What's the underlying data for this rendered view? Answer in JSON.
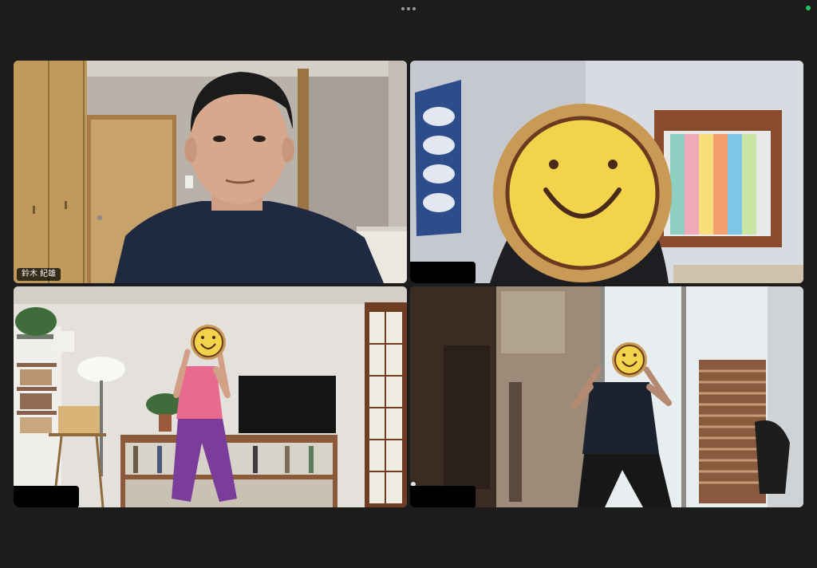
{
  "window": {
    "more_icon": "more-horizontal-icon",
    "status_color": "#22c55e"
  },
  "participants": [
    {
      "name": "鈴木 紀雄",
      "redacted": false,
      "active": false
    },
    {
      "name": "",
      "redacted": true,
      "active": false
    },
    {
      "name": "",
      "redacted": true,
      "active": false
    },
    {
      "name": "",
      "redacted": true,
      "active": true
    }
  ],
  "colors": {
    "background": "#1c1c1c",
    "active_speaker_border": "#22c55e",
    "smiley_face": "#f4d34c",
    "smiley_wood": "#c99a55"
  }
}
